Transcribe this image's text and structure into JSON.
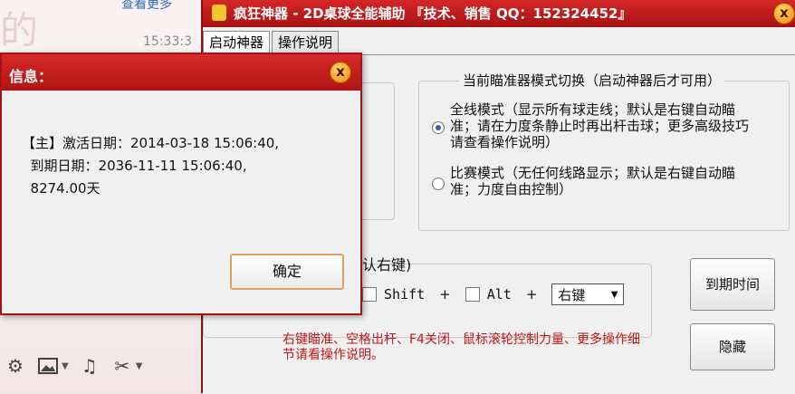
{
  "chat": {
    "link_text": "查看更多",
    "time": "15:33:3",
    "deco_text": "的"
  },
  "app": {
    "title": "疯狂神器 - 2D桌球全能辅助 『技术、销售 QQ：152324452』",
    "close": "x",
    "tabs": [
      {
        "label": "启动神器",
        "active": true
      },
      {
        "label": "操作说明",
        "active": false
      }
    ],
    "mode_group": {
      "legend": "当前瞄准器模式切换（启动神器后才可用）",
      "options": [
        {
          "text": "全线模式（显示所有球走线；默认是右键自动瞄准；请在力度条静止时再出杆击球；更多高级技巧请查看操作说明）",
          "selected": true
        },
        {
          "text": "比赛模式（无任何线路显示；默认是右键自动瞄准；力度自由控制）",
          "selected": false
        }
      ]
    },
    "hotkey": {
      "label": "认右键)",
      "shift": "Shift",
      "alt": "Alt",
      "plus": "+",
      "select_value": "右键"
    },
    "hint": "右键瞄准、空格出杆、F4关闭、鼠标滚轮控制力量、更多操作细节请看操作说明。",
    "buttons": {
      "expire": "到期时间",
      "hide": "隐藏"
    }
  },
  "dialog": {
    "title": "信息：",
    "close": "x",
    "lines": [
      "【主】激活日期：2014-03-18 15:06:40,",
      "  到期日期：2036-11-11 15:06:40,",
      "  8274.00天"
    ],
    "ok": "确定"
  }
}
